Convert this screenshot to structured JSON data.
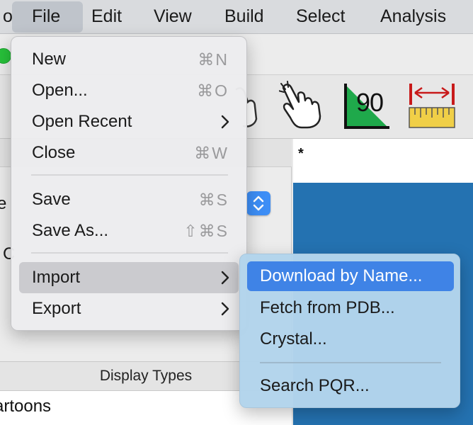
{
  "menubar": {
    "items": [
      {
        "label": "o"
      },
      {
        "label": "File"
      },
      {
        "label": "Edit"
      },
      {
        "label": "View"
      },
      {
        "label": "Build"
      },
      {
        "label": "Select"
      },
      {
        "label": "Analysis"
      }
    ]
  },
  "file_menu": {
    "items": [
      {
        "label": "New",
        "shortcut": "⌘N"
      },
      {
        "label": "Open...",
        "shortcut": "⌘O"
      },
      {
        "label": "Open Recent"
      },
      {
        "label": "Close",
        "shortcut": "⌘W"
      },
      {
        "label": "Save",
        "shortcut": "⌘S"
      },
      {
        "label": "Save As...",
        "shortcut": "⇧⌘S"
      },
      {
        "label": "Import"
      },
      {
        "label": "Export"
      }
    ]
  },
  "import_submenu": {
    "items": [
      {
        "label": "Download by Name..."
      },
      {
        "label": "Fetch from PDB..."
      },
      {
        "label": "Crystal..."
      },
      {
        "label": "Search PQR..."
      }
    ]
  },
  "toolbar": {
    "angle_value": "90"
  },
  "sidebar": {
    "partial_label_1": "e",
    "partial_label_2": "C",
    "display_types_header": "Display Types",
    "display_type_row": "artoons"
  },
  "viewer": {
    "tab_marker": "*"
  },
  "colors": {
    "accent": "#3f83e6",
    "viewer_bg": "#2472b1",
    "submenu_bg": "#b2d4ec"
  }
}
